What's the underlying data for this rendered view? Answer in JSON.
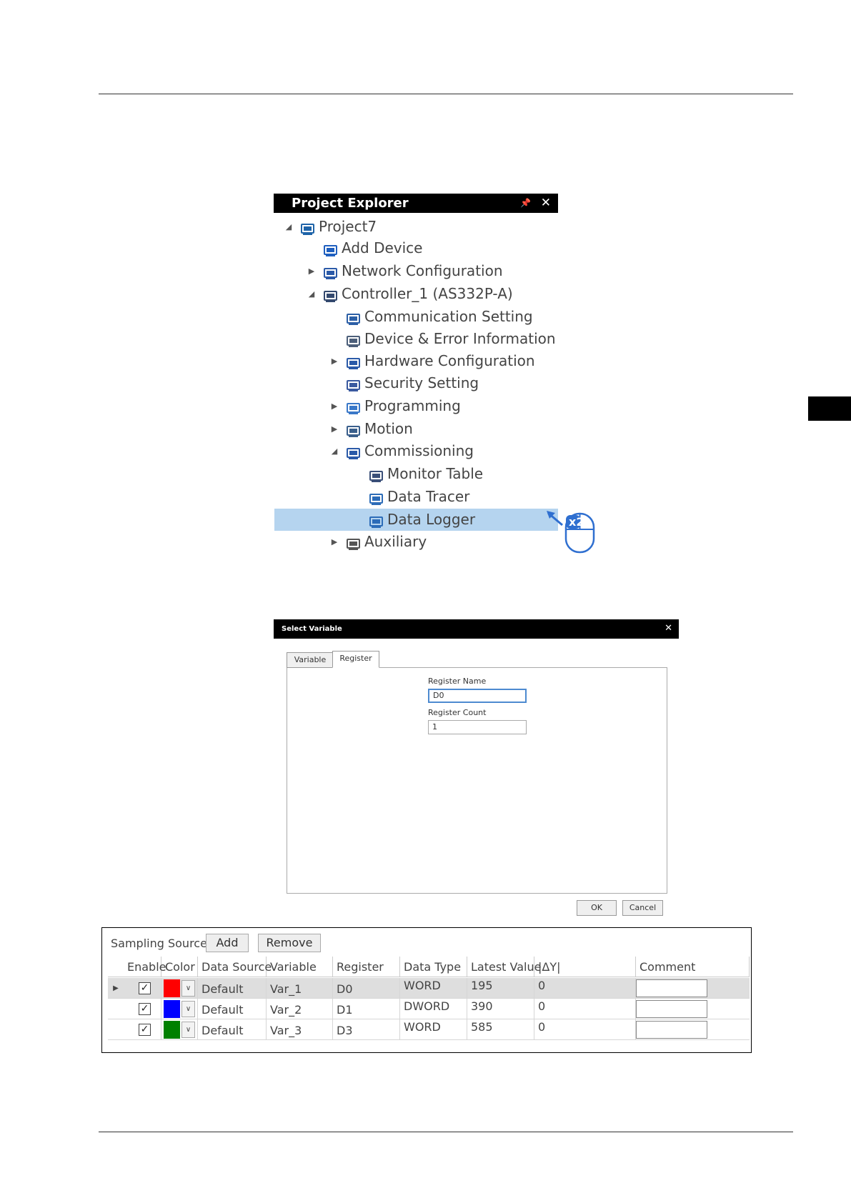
{
  "project_explorer": {
    "title": "Project Explorer",
    "pin_glyph": "📌",
    "close_glyph": "✕",
    "items": [
      {
        "label": "Project7",
        "arrow": "◢",
        "icon": "project-icon"
      },
      {
        "label": "Add Device",
        "arrow": "",
        "icon": "add-device-icon"
      },
      {
        "label": "Network Configuration",
        "arrow": "▶",
        "icon": "network-icon"
      },
      {
        "label": "Controller_1 (AS332P-A)",
        "arrow": "◢",
        "icon": "controller-icon"
      },
      {
        "label": "Communication Setting",
        "arrow": "",
        "icon": "communication-icon"
      },
      {
        "label": "Device & Error Information",
        "arrow": "",
        "icon": "device-info-icon"
      },
      {
        "label": "Hardware Configuration",
        "arrow": "▶",
        "icon": "hardware-icon"
      },
      {
        "label": "Security Setting",
        "arrow": "",
        "icon": "security-icon"
      },
      {
        "label": "Programming",
        "arrow": "▶",
        "icon": "programming-icon"
      },
      {
        "label": "Motion",
        "arrow": "▶",
        "icon": "motion-icon"
      },
      {
        "label": "Commissioning",
        "arrow": "◢",
        "icon": "commissioning-icon"
      },
      {
        "label": "Monitor Table",
        "arrow": "",
        "icon": "monitor-table-icon"
      },
      {
        "label": "Data Tracer",
        "arrow": "",
        "icon": "data-tracer-icon"
      },
      {
        "label": "Data Logger",
        "arrow": "",
        "icon": "data-logger-icon"
      },
      {
        "label": "Auxiliary",
        "arrow": "▶",
        "icon": "auxiliary-icon"
      }
    ],
    "selected_index": 13,
    "double_click_badge": "x2"
  },
  "select_variable": {
    "title": "Select Variable",
    "close_glyph": "✕",
    "tabs": [
      "Variable",
      "Register"
    ],
    "active_tab": "Register",
    "register_name_label": "Register Name",
    "register_name_value": "D0",
    "register_count_label": "Register Count",
    "register_count_value": "1",
    "ok_label": "OK",
    "cancel_label": "Cancel"
  },
  "sampling": {
    "label": "Sampling Source",
    "add_label": "Add",
    "remove_label": "Remove",
    "columns": [
      "Enable",
      "Color",
      "Data Source",
      "Variable",
      "Register",
      "Data Type",
      "Latest Value",
      "|ΔY|",
      "Comment"
    ],
    "rows": [
      {
        "enable": "✓",
        "color": "#ff0000",
        "data_source": "Default",
        "variable": "Var_1",
        "register": "D0",
        "data_type": "WORD",
        "latest_value": "195",
        "delta_y": "0",
        "comment": ""
      },
      {
        "enable": "✓",
        "color": "#0000ff",
        "data_source": "Default",
        "variable": "Var_2",
        "register": "D1",
        "data_type": "DWORD",
        "latest_value": "390",
        "delta_y": "0",
        "comment": ""
      },
      {
        "enable": "✓",
        "color": "#008000",
        "data_source": "Default",
        "variable": "Var_3",
        "register": "D3",
        "data_type": "WORD",
        "latest_value": "585",
        "delta_y": "0",
        "comment": ""
      }
    ],
    "current_row_marker": "▶",
    "dropdown_glyph": "∨"
  }
}
